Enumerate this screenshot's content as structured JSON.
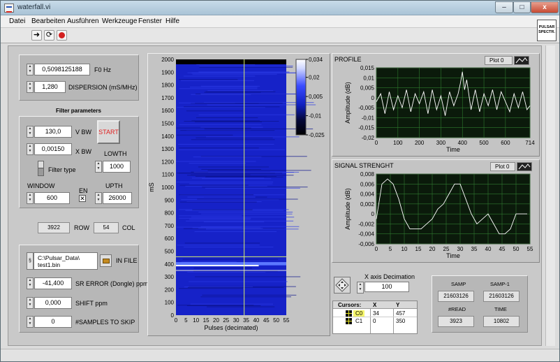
{
  "window": {
    "title": "waterfall.vi",
    "minimize": "–",
    "maximize": "□",
    "close": "x"
  },
  "menu": [
    "Datei",
    "Bearbeiten",
    "Ausführen",
    "Werkzeuge",
    "Fenster",
    "Hilfe"
  ],
  "logo": {
    "line1": "PULSAR",
    "line2": "SPECTR."
  },
  "controls": {
    "f0": {
      "value": "0,5098125188",
      "label": "F0 Hz"
    },
    "dispersion": {
      "value": "1,280",
      "label": "DISPERSION (mS/MHz)"
    },
    "filter_title": "Filter parameters",
    "vbw": {
      "value": "130,0",
      "label": "V BW"
    },
    "xbw": {
      "value": "0,00150",
      "label": "X BW"
    },
    "start_label": "START",
    "lowth": {
      "label": "LOWTH",
      "value": "1000"
    },
    "filter_type_label": "Filter type",
    "window": {
      "label": "WINDOW",
      "value": "600"
    },
    "en_label": "EN",
    "upth": {
      "label": "UPTH",
      "value": "26000"
    },
    "row": {
      "value": "3922",
      "label": "ROW"
    },
    "col": {
      "value": "54",
      "label": "COL"
    },
    "infile": {
      "value_line1": "C:\\Pulsar_Data\\",
      "value_line2": "test1.bin",
      "label": "IN FILE"
    },
    "sr_error": {
      "value": "-41,400",
      "label": "SR ERROR (Dongle) ppm"
    },
    "shift": {
      "value": "0,000",
      "label": "SHIFT ppm"
    },
    "skip": {
      "value": "0",
      "label": "#SAMPLES TO SKIP"
    }
  },
  "waterfall": {
    "ylabel": "mS",
    "xlabel": "Pulses (decimated)",
    "yticks": [
      "2000",
      "1900",
      "1800",
      "1700",
      "1600",
      "1500",
      "1400",
      "1300",
      "1200",
      "1100",
      "1000",
      "900",
      "800",
      "700",
      "600",
      "500",
      "400",
      "300",
      "200",
      "100",
      "0"
    ],
    "xticks": [
      "0",
      "5",
      "10",
      "15",
      "20",
      "25",
      "30",
      "35",
      "40",
      "45",
      "50",
      "55"
    ],
    "colorbar_ticks": [
      "0,034",
      "0,02",
      "0,005",
      "-0,01",
      "-0,025"
    ]
  },
  "profile": {
    "title": "PROFILE",
    "plot_label": "Plot 0",
    "ylabel": "Amplitude (dB)",
    "xlabel": "Time",
    "yticks": [
      "0,015",
      "0,01",
      "0,005",
      "0",
      "-0,005",
      "-0,01",
      "-0,015",
      "-0,02"
    ],
    "xticks": [
      "0",
      "100",
      "200",
      "300",
      "400",
      "500",
      "600",
      "714"
    ]
  },
  "signal": {
    "title": "SIGNAL STRENGHT",
    "plot_label": "Plot 0",
    "ylabel": "Amplitude (dB)",
    "xlabel": "Time",
    "yticks": [
      "0,008",
      "0,006",
      "0,004",
      "0,002",
      "0",
      "-0,002",
      "-0,004",
      "-0,006"
    ],
    "xticks": [
      "0",
      "5",
      "10",
      "15",
      "20",
      "25",
      "30",
      "35",
      "40",
      "45",
      "50",
      "55"
    ]
  },
  "decimation": {
    "label": "X axis Decimation",
    "value": "100"
  },
  "cursors": {
    "headers": [
      "Cursors:",
      "X",
      "Y"
    ],
    "rows": [
      {
        "name": "C0",
        "x": "34",
        "y": "457"
      },
      {
        "name": "C1",
        "x": "0",
        "y": "350"
      }
    ]
  },
  "stats": {
    "samp": {
      "label": "SAMP",
      "value": "21603126"
    },
    "samp1": {
      "label": "SAMP-1",
      "value": "21603126"
    },
    "read": {
      "label": "#READ",
      "value": "3923"
    },
    "time": {
      "label": "TIME",
      "value": "10802"
    }
  },
  "chart_data": [
    {
      "type": "line",
      "title": "PROFILE",
      "xlabel": "Time",
      "ylabel": "Amplitude (dB)",
      "xlim": [
        0,
        714
      ],
      "ylim": [
        -0.02,
        0.015
      ],
      "grid": true,
      "series": [
        {
          "name": "Plot 0",
          "x": [
            0,
            20,
            40,
            60,
            80,
            100,
            120,
            140,
            160,
            180,
            200,
            220,
            240,
            260,
            280,
            300,
            320,
            340,
            360,
            380,
            390,
            400,
            410,
            420,
            440,
            460,
            480,
            500,
            520,
            540,
            560,
            580,
            600,
            620,
            640,
            660,
            680,
            700,
            714
          ],
          "y": [
            -0.002,
            0.002,
            -0.008,
            0.003,
            -0.006,
            0.001,
            -0.005,
            0.004,
            -0.007,
            0.002,
            -0.003,
            0.003,
            -0.008,
            0.004,
            -0.006,
            0.001,
            -0.009,
            0.003,
            -0.004,
            0.002,
            0.007,
            0.013,
            0.004,
            0.009,
            -0.006,
            0.004,
            -0.007,
            0.002,
            -0.004,
            0.004,
            -0.006,
            0.003,
            -0.002,
            -0.007,
            0.002,
            -0.005,
            0.003,
            -0.006,
            -0.004
          ]
        }
      ]
    },
    {
      "type": "line",
      "title": "SIGNAL STRENGHT",
      "xlabel": "Time",
      "ylabel": "Amplitude (dB)",
      "xlim": [
        0,
        55
      ],
      "ylim": [
        -0.006,
        0.008
      ],
      "grid": true,
      "series": [
        {
          "name": "Plot 0",
          "x": [
            0,
            2,
            4,
            6,
            8,
            10,
            12,
            14,
            16,
            18,
            20,
            22,
            24,
            26,
            28,
            30,
            32,
            34,
            36,
            38,
            40,
            42,
            44,
            46,
            48,
            50,
            52,
            54
          ],
          "y": [
            -0.001,
            0.006,
            0.007,
            0.006,
            0.003,
            -0.001,
            -0.003,
            -0.003,
            -0.003,
            -0.002,
            -0.001,
            0.001,
            0.002,
            0.004,
            0.006,
            0.006,
            0.003,
            0.0,
            -0.002,
            -0.001,
            0.0,
            -0.002,
            -0.004,
            -0.004,
            -0.003,
            0.0,
            0.0,
            0.0
          ]
        }
      ]
    },
    {
      "type": "heatmap",
      "xlabel": "Pulses (decimated)",
      "ylabel": "mS",
      "xlim": [
        0,
        55
      ],
      "ylim": [
        0,
        2000
      ],
      "colorbar_range": [
        -0.025,
        0.034
      ],
      "cursors": [
        {
          "x": 34,
          "y": 457
        },
        {
          "x": 0,
          "y": 350
        }
      ],
      "bright_band_ms": [
        390,
        415
      ]
    }
  ]
}
